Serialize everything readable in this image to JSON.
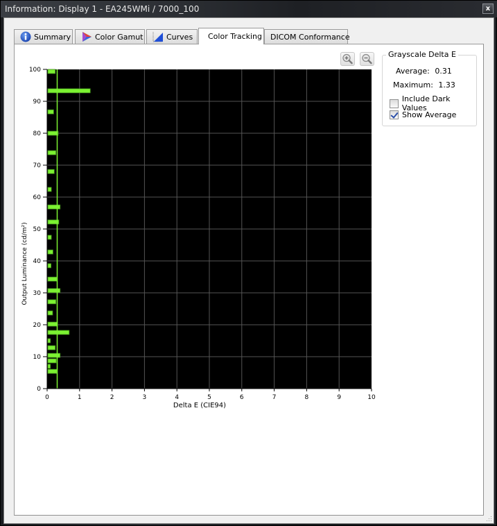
{
  "window": {
    "title": "Information: Display 1 - EA245WMi / 7000_100",
    "close_label": "x"
  },
  "tabs": [
    {
      "label": "Summary",
      "icon": "info-icon",
      "active": false
    },
    {
      "label": "Color Gamut",
      "icon": "color-gamut-icon",
      "active": false
    },
    {
      "label": "Curves",
      "icon": "curves-icon",
      "active": false
    },
    {
      "label": "Color Tracking",
      "icon": "",
      "active": true
    },
    {
      "label": "DICOM Conformance",
      "icon": "",
      "active": false
    }
  ],
  "toolbar": {
    "zoom_in_icon": "zoom-in-icon",
    "zoom_out_icon": "zoom-out-icon"
  },
  "stats": {
    "group_title": "Grayscale Delta E",
    "average_label": "Average:",
    "average_value": "0.31",
    "maximum_label": "Maximum:",
    "maximum_value": "1.33",
    "include_dark_label": "Include Dark Values",
    "include_dark_checked": false,
    "show_average_label": "Show Average",
    "show_average_checked": true
  },
  "colors": {
    "plot_background": "#000000",
    "bar_fill": "#7cf232",
    "bar_edge": "#3f8a1a",
    "average_line": "#7cf232",
    "grid": "#555555"
  },
  "chart_data": {
    "type": "bar",
    "orientation": "horizontal",
    "title": "",
    "xlabel": "Delta E (CIE94)",
    "ylabel": "Output Luminance (cd/m²)",
    "xlim": [
      0,
      10
    ],
    "ylim": [
      0,
      100
    ],
    "xticks": [
      "0",
      "1",
      "2",
      "3",
      "4",
      "5",
      "6",
      "7",
      "8",
      "9",
      "10"
    ],
    "yticks": [
      "0",
      "10",
      "20",
      "30",
      "40",
      "50",
      "60",
      "70",
      "80",
      "90",
      "100"
    ],
    "grid": true,
    "average_line": 0.31,
    "bars": [
      {
        "luminance": 100.0,
        "delta_e": 0.25
      },
      {
        "luminance": 93.3,
        "delta_e": 1.33
      },
      {
        "luminance": 86.7,
        "delta_e": 0.2
      },
      {
        "luminance": 80.0,
        "delta_e": 0.34
      },
      {
        "luminance": 73.9,
        "delta_e": 0.27
      },
      {
        "luminance": 68.0,
        "delta_e": 0.22
      },
      {
        "luminance": 62.4,
        "delta_e": 0.13
      },
      {
        "luminance": 56.9,
        "delta_e": 0.4
      },
      {
        "luminance": 52.2,
        "delta_e": 0.36
      },
      {
        "luminance": 47.4,
        "delta_e": 0.13
      },
      {
        "luminance": 42.8,
        "delta_e": 0.18
      },
      {
        "luminance": 38.5,
        "delta_e": 0.12
      },
      {
        "luminance": 34.3,
        "delta_e": 0.3
      },
      {
        "luminance": 30.7,
        "delta_e": 0.4
      },
      {
        "luminance": 27.2,
        "delta_e": 0.27
      },
      {
        "luminance": 23.7,
        "delta_e": 0.17
      },
      {
        "luminance": 20.2,
        "delta_e": 0.32
      },
      {
        "luminance": 17.6,
        "delta_e": 0.68
      },
      {
        "luminance": 15.0,
        "delta_e": 0.1
      },
      {
        "luminance": 12.8,
        "delta_e": 0.25
      },
      {
        "luminance": 10.4,
        "delta_e": 0.4
      },
      {
        "luminance": 8.7,
        "delta_e": 0.28
      },
      {
        "luminance": 7.0,
        "delta_e": 0.1
      },
      {
        "luminance": 5.4,
        "delta_e": 0.3
      }
    ]
  }
}
